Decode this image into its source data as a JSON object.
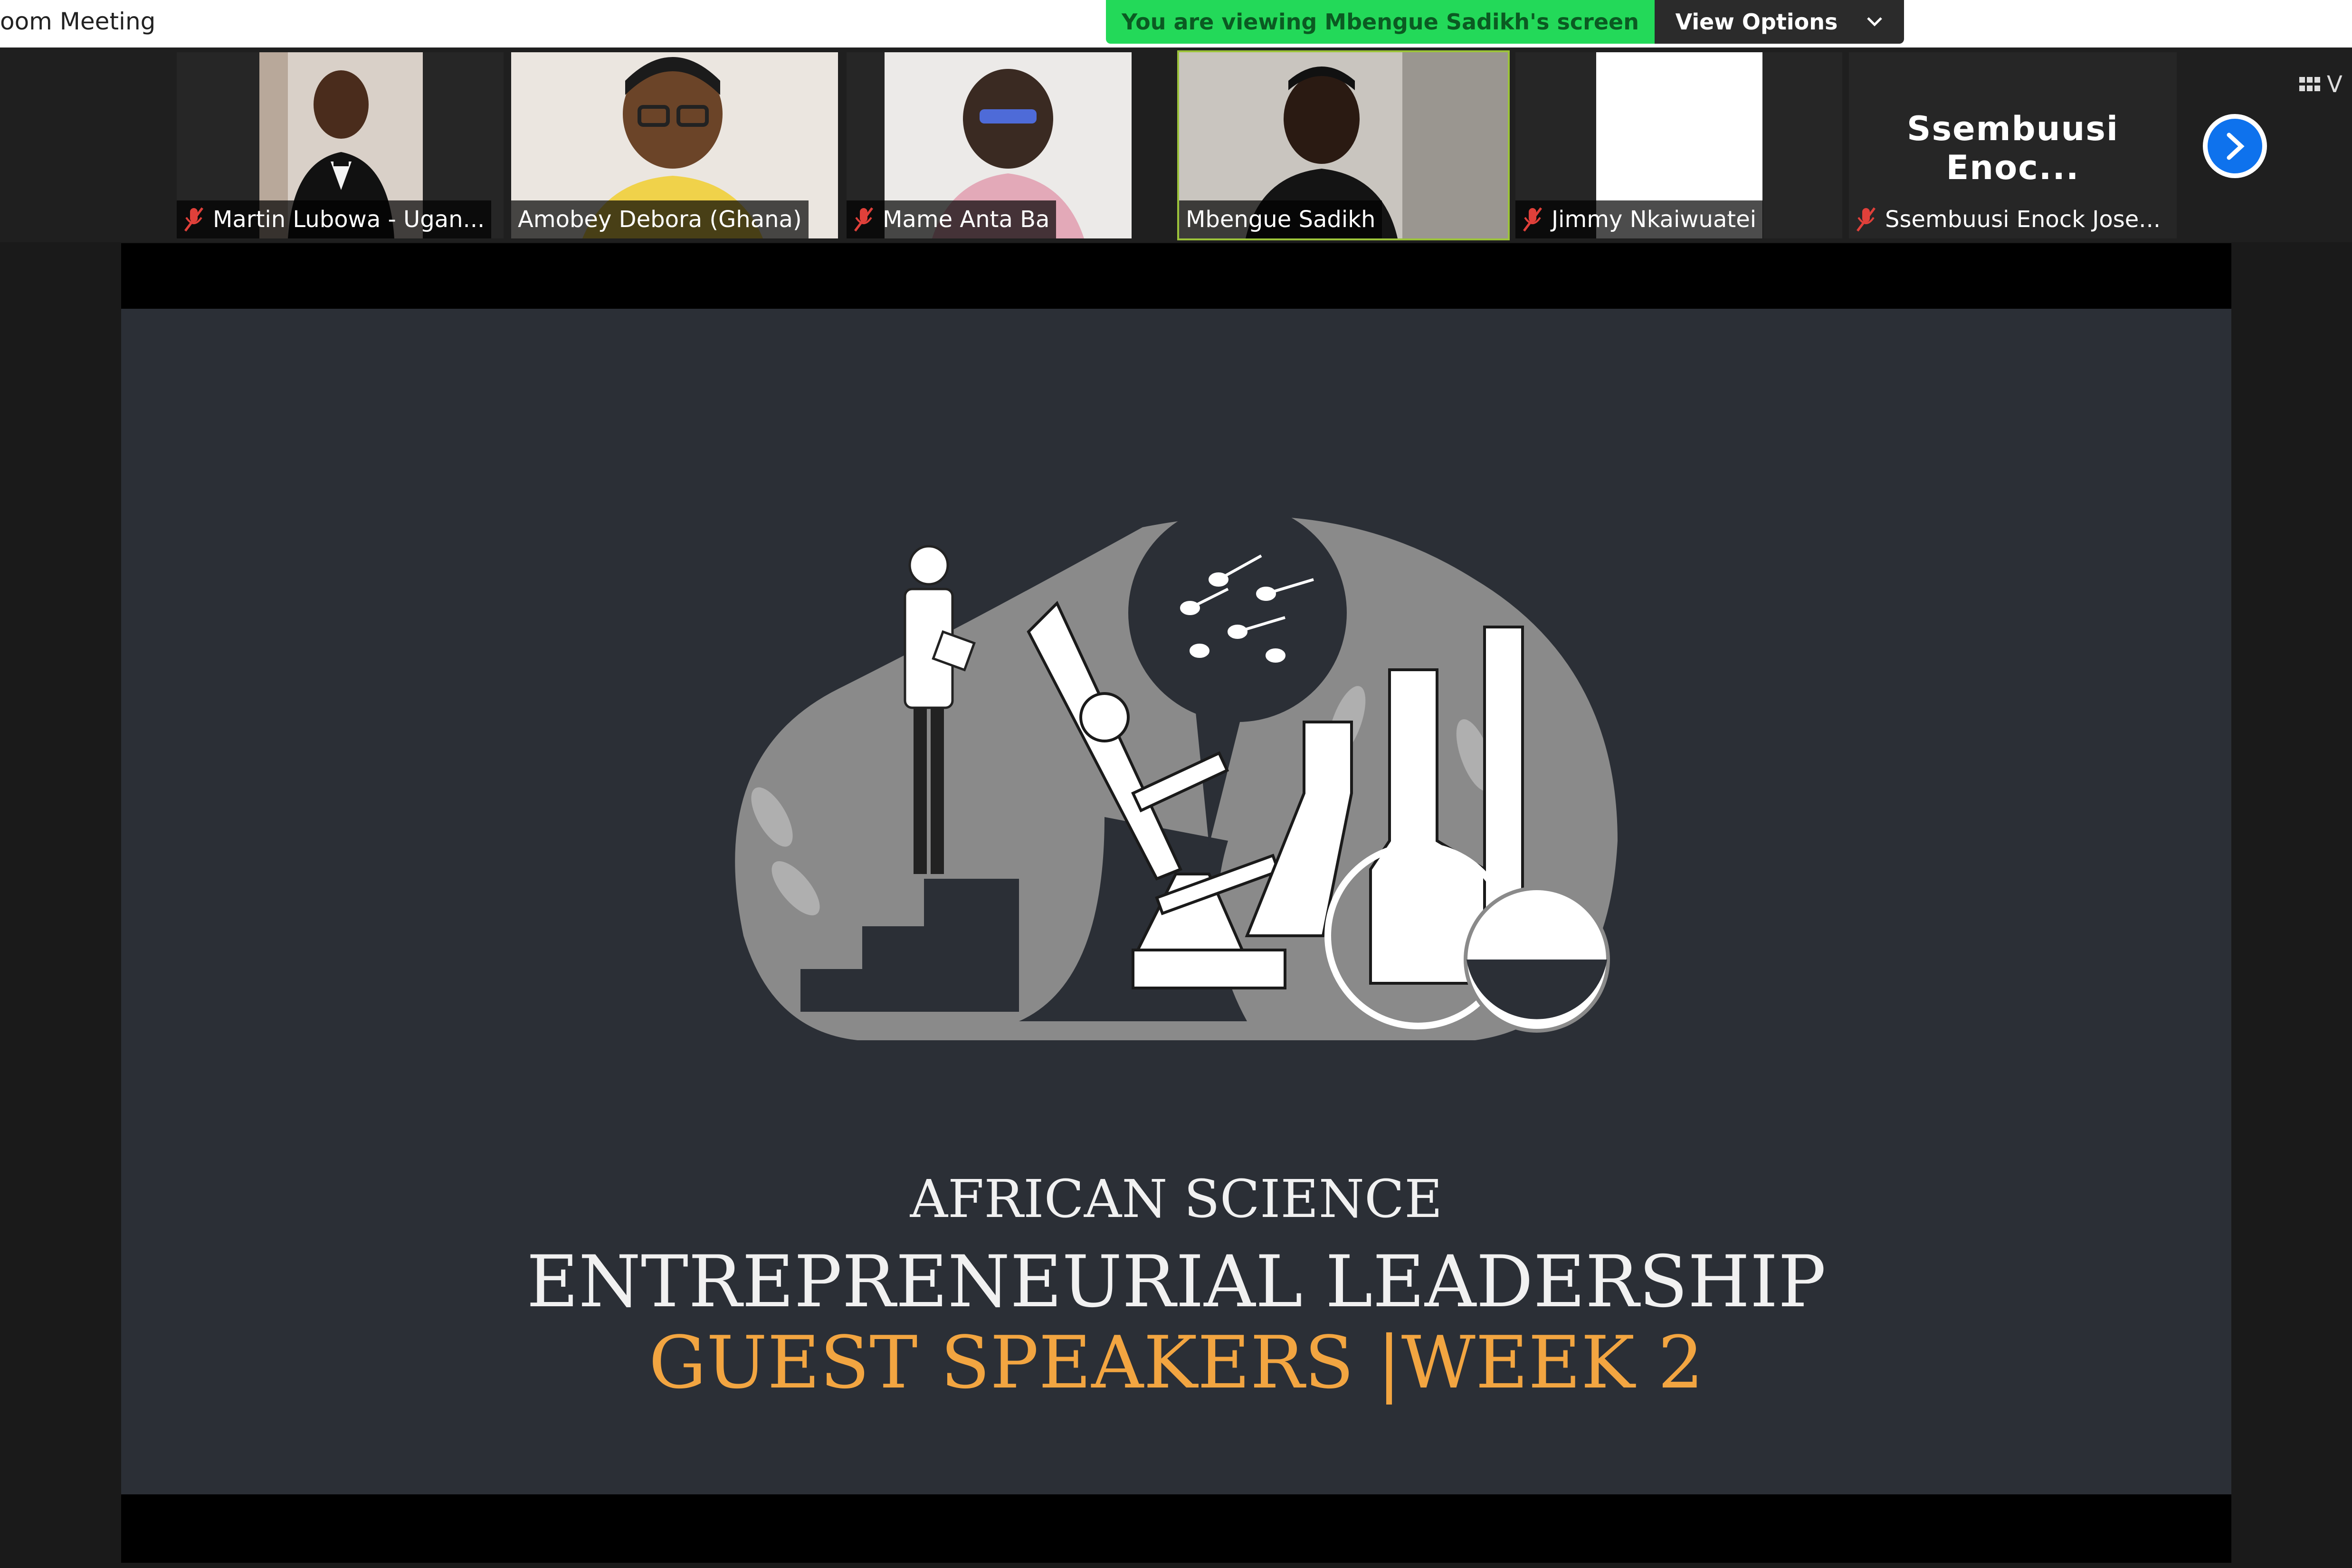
{
  "window": {
    "title": "oom Meeting"
  },
  "share_banner": {
    "message": "You are viewing Mbengue Sadikh's screen",
    "view_options": "View Options",
    "colors": {
      "banner_green": "#23d959",
      "options_bg": "#2b2b2b"
    }
  },
  "participants": [
    {
      "name": "Martin Lubowa - Ugan...",
      "muted": true
    },
    {
      "name": "Amobey Debora (Ghana)",
      "muted": false
    },
    {
      "name": "Mame Anta Ba",
      "muted": true
    },
    {
      "name": "Mbengue Sadikh",
      "muted": false,
      "active": true
    },
    {
      "name": "Jimmy Nkaiwuatei",
      "muted": true
    },
    {
      "name": "Ssembuusi Enock Jose...",
      "display_name": "Ssembuusi Enoc...",
      "muted": true
    }
  ],
  "controls": {
    "next_icon": "chevron-right-icon",
    "view_label": "V",
    "view_icon": "grid-icon"
  },
  "slide": {
    "line1": "AFRICAN SCIENCE",
    "line2": "ENTREPRENEURIAL LEADERSHIP",
    "line3": "GUEST SPEAKERS |WEEK 2",
    "colors": {
      "background": "#2b2f36",
      "accent": "#f2a541",
      "text": "#f1f1f1"
    }
  }
}
